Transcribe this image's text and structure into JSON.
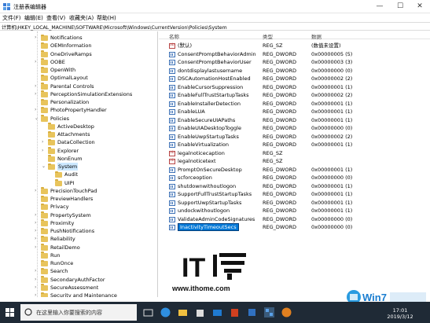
{
  "window": {
    "title": "注册表编辑器",
    "minimize": "—",
    "maximize": "☐",
    "close": "✕"
  },
  "menu": [
    "文件(F)",
    "编辑(E)",
    "查看(V)",
    "收藏夹(A)",
    "帮助(H)"
  ],
  "address": "计算机\\HKEY_LOCAL_MACHINE\\SOFTWARE\\Microsoft\\Windows\\CurrentVersion\\Policies\\System",
  "tree": {
    "items": [
      {
        "label": "Notifications",
        "level": 0,
        "expander": "›"
      },
      {
        "label": "OEMInformation",
        "level": 0,
        "expander": ""
      },
      {
        "label": "OneDriveRamps",
        "level": 0,
        "expander": ""
      },
      {
        "label": "OOBE",
        "level": 0,
        "expander": "›"
      },
      {
        "label": "OpenWith",
        "level": 0,
        "expander": ""
      },
      {
        "label": "OptimalLayout",
        "level": 0,
        "expander": ""
      },
      {
        "label": "Parental Controls",
        "level": 0,
        "expander": "›"
      },
      {
        "label": "PerceptionSimulationExtensions",
        "level": 0,
        "expander": "›"
      },
      {
        "label": "Personalization",
        "level": 0,
        "expander": ""
      },
      {
        "label": "PhotoPropertyHandler",
        "level": 0,
        "expander": "›"
      },
      {
        "label": "Policies",
        "level": 0,
        "expander": "⌄"
      },
      {
        "label": "ActiveDesktop",
        "level": 1,
        "expander": ""
      },
      {
        "label": "Attachments",
        "level": 1,
        "expander": ""
      },
      {
        "label": "DataCollection",
        "level": 1,
        "expander": "›"
      },
      {
        "label": "Explorer",
        "level": 1,
        "expander": "›"
      },
      {
        "label": "NonEnum",
        "level": 1,
        "expander": ""
      },
      {
        "label": "System",
        "level": 1,
        "expander": "⌄",
        "selected": true
      },
      {
        "label": "Audit",
        "level": 2,
        "expander": ""
      },
      {
        "label": "UIPI",
        "level": 2,
        "expander": ""
      },
      {
        "label": "PrecisionTouchPad",
        "level": 0,
        "expander": "›"
      },
      {
        "label": "PreviewHandlers",
        "level": 0,
        "expander": ""
      },
      {
        "label": "Privacy",
        "level": 0,
        "expander": ""
      },
      {
        "label": "PropertySystem",
        "level": 0,
        "expander": "›"
      },
      {
        "label": "Proximity",
        "level": 0,
        "expander": "›"
      },
      {
        "label": "PushNotifications",
        "level": 0,
        "expander": "›"
      },
      {
        "label": "Reliability",
        "level": 0,
        "expander": "›"
      },
      {
        "label": "RetailDemo",
        "level": 0,
        "expander": "›"
      },
      {
        "label": "Run",
        "level": 0,
        "expander": ""
      },
      {
        "label": "RunOnce",
        "level": 0,
        "expander": ""
      },
      {
        "label": "Search",
        "level": 0,
        "expander": "›"
      },
      {
        "label": "SecondaryAuthFactor",
        "level": 0,
        "expander": "›"
      },
      {
        "label": "SecureAssessment",
        "level": 0,
        "expander": "›"
      },
      {
        "label": "Security and Maintenance",
        "level": 0,
        "expander": "›"
      }
    ]
  },
  "list": {
    "headers": {
      "name": "名称",
      "type": "类型",
      "data": "数据"
    },
    "rows": [
      {
        "name": "(默认)",
        "type": "REG_SZ",
        "data": "(数值未设置)",
        "icon": "sz"
      },
      {
        "name": "ConsentPromptBehaviorAdmin",
        "type": "REG_DWORD",
        "data": "0x00000005 (5)",
        "icon": "bin"
      },
      {
        "name": "ConsentPromptBehaviorUser",
        "type": "REG_DWORD",
        "data": "0x00000003 (3)",
        "icon": "bin"
      },
      {
        "name": "dontdisplaylastusername",
        "type": "REG_DWORD",
        "data": "0x00000000 (0)",
        "icon": "bin"
      },
      {
        "name": "DSCAutomationHostEnabled",
        "type": "REG_DWORD",
        "data": "0x00000002 (2)",
        "icon": "bin"
      },
      {
        "name": "EnableCursorSuppression",
        "type": "REG_DWORD",
        "data": "0x00000001 (1)",
        "icon": "bin"
      },
      {
        "name": "EnableFullTrustStartupTasks",
        "type": "REG_DWORD",
        "data": "0x00000002 (2)",
        "icon": "bin"
      },
      {
        "name": "EnableInstallerDetection",
        "type": "REG_DWORD",
        "data": "0x00000001 (1)",
        "icon": "bin"
      },
      {
        "name": "EnableLUA",
        "type": "REG_DWORD",
        "data": "0x00000001 (1)",
        "icon": "bin"
      },
      {
        "name": "EnableSecureUIAPaths",
        "type": "REG_DWORD",
        "data": "0x00000001 (1)",
        "icon": "bin"
      },
      {
        "name": "EnableUIADesktopToggle",
        "type": "REG_DWORD",
        "data": "0x00000000 (0)",
        "icon": "bin"
      },
      {
        "name": "EnableUwpStartupTasks",
        "type": "REG_DWORD",
        "data": "0x00000002 (2)",
        "icon": "bin"
      },
      {
        "name": "EnableVirtualization",
        "type": "REG_DWORD",
        "data": "0x00000001 (1)",
        "icon": "bin"
      },
      {
        "name": "legalnoticecaption",
        "type": "REG_SZ",
        "data": "",
        "icon": "sz"
      },
      {
        "name": "legalnoticetext",
        "type": "REG_SZ",
        "data": "",
        "icon": "sz"
      },
      {
        "name": "PromptOnSecureDesktop",
        "type": "REG_DWORD",
        "data": "0x00000001 (1)",
        "icon": "bin"
      },
      {
        "name": "scforceoption",
        "type": "REG_DWORD",
        "data": "0x00000000 (0)",
        "icon": "bin"
      },
      {
        "name": "shutdownwithoutlogon",
        "type": "REG_DWORD",
        "data": "0x00000001 (1)",
        "icon": "bin"
      },
      {
        "name": "SupportFullTrustStartupTasks",
        "type": "REG_DWORD",
        "data": "0x00000001 (1)",
        "icon": "bin"
      },
      {
        "name": "SupportUwpStartupTasks",
        "type": "REG_DWORD",
        "data": "0x00000001 (1)",
        "icon": "bin"
      },
      {
        "name": "undockwithoutlogon",
        "type": "REG_DWORD",
        "data": "0x00000001 (1)",
        "icon": "bin"
      },
      {
        "name": "ValidateAdminCodeSignatures",
        "type": "REG_DWORD",
        "data": "0x00000000 (0)",
        "icon": "bin"
      },
      {
        "name": "InactivityTimeoutSecs",
        "type": "REG_DWORD",
        "data": "0x00000000 (0)",
        "icon": "bin",
        "editing": true
      }
    ]
  },
  "watermark": {
    "url": "www.ithome.com"
  },
  "taskbar": {
    "search_placeholder": "在这里输入你要搜索的内容",
    "time": "17:01",
    "date": "2019/3/12"
  }
}
